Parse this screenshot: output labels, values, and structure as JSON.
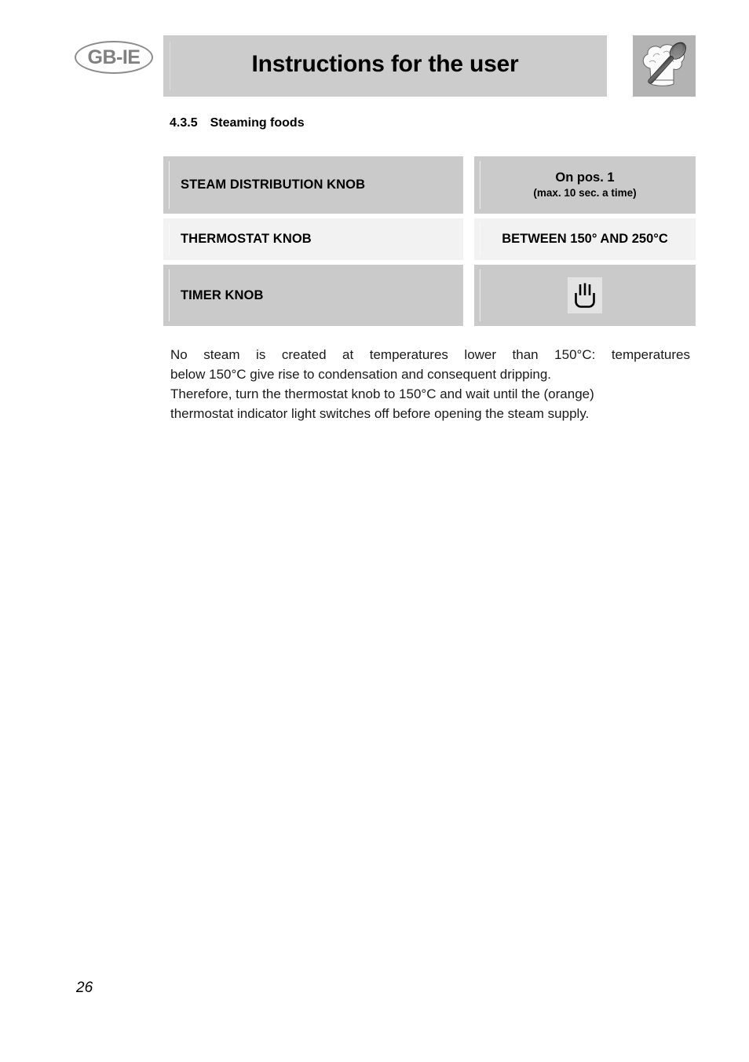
{
  "header": {
    "language_badge": "GB-IE",
    "title": "Instructions for the user",
    "chef_icon": "chef-hat-spoon-icon"
  },
  "section": {
    "number": "4.3.5",
    "heading": "Steaming foods"
  },
  "table": {
    "rows": [
      {
        "label": "STEAM DISTRIBUTION KNOB",
        "value_main": "On pos. 1",
        "value_sub": "(max. 10 sec. a time)",
        "style": "dark"
      },
      {
        "label": "THERMOSTAT KNOB",
        "value_main": "BETWEEN 150° AND 250°C",
        "value_sub": "",
        "style": "light"
      },
      {
        "label": "TIMER KNOB",
        "value_main": "",
        "value_sub": "",
        "icon": "manual-hand-icon",
        "style": "dark"
      }
    ]
  },
  "body": {
    "line1": "No steam is created at temperatures lower than 150°C: temperatures",
    "line2": "below 150°C give rise to condensation and consequent dripping.",
    "line3": "Therefore, turn the thermostat knob to 150°C and wait until the (orange)",
    "line4": "thermostat indicator light switches off before opening the steam supply."
  },
  "footer": {
    "page_number": "26"
  },
  "colors": {
    "header_bar": "#cccccc",
    "row_dark": "#cacaca",
    "row_light": "#f2f2f2",
    "icon_box": "#b3b3b3",
    "badge_text": "#808080"
  }
}
